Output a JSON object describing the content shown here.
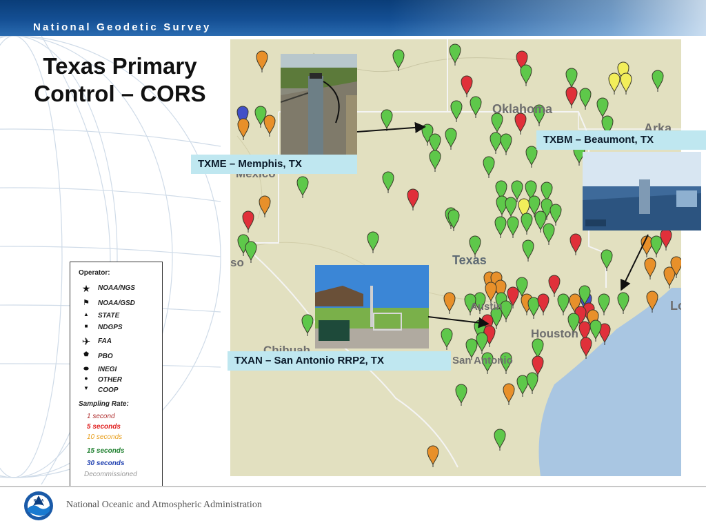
{
  "header": {
    "agency": "National Geodetic Survey"
  },
  "slide": {
    "title_line1": "Texas Primary",
    "title_line2": "Control – CORS"
  },
  "callouts": {
    "memphis": "TXME – Memphis, TX",
    "beaumont": "TXBM – Beaumont, TX",
    "san_antonio": "TXAN – San Antonio RRP2, TX"
  },
  "map_labels": {
    "oklahoma": "Oklahoma",
    "arkansas": "Arka",
    "texas": "Texas",
    "mexico": "Mexico",
    "chihuahua": "Chihuah",
    "houston": "Houston",
    "austin": "Austin",
    "san_antonio": "San Antonio",
    "louisiana": "Lo",
    "so": "so"
  },
  "legend": {
    "operator_title": "Operator:",
    "operators": [
      "NOAA/NGS",
      "NOAA/GSD",
      "STATE",
      "NDGPS",
      "FAA",
      "PBO",
      "INEGI",
      "OTHER",
      "COOP"
    ],
    "sampling_title": "Sampling Rate:",
    "rates": [
      {
        "label": "1 second",
        "color": "#b03030"
      },
      {
        "label": "5 seconds",
        "color": "#e02020"
      },
      {
        "label": "10 seconds",
        "color": "#e8a020"
      },
      {
        "label": "15 seconds",
        "color": "#208030"
      },
      {
        "label": "30 seconds",
        "color": "#2040b0"
      },
      {
        "label": "Decommissioned",
        "color": "#999999"
      }
    ]
  },
  "footer": {
    "org": "National Oceanic and Atmospheric Administration",
    "logo_text": "NOAA"
  },
  "colors": {
    "green": "#5ec84a",
    "red": "#e0303a",
    "orange": "#e8902a",
    "yellow": "#f2ee5a",
    "blue": "#4050c8",
    "header": "#144f94",
    "callout_bg": "#bfe7f0"
  }
}
